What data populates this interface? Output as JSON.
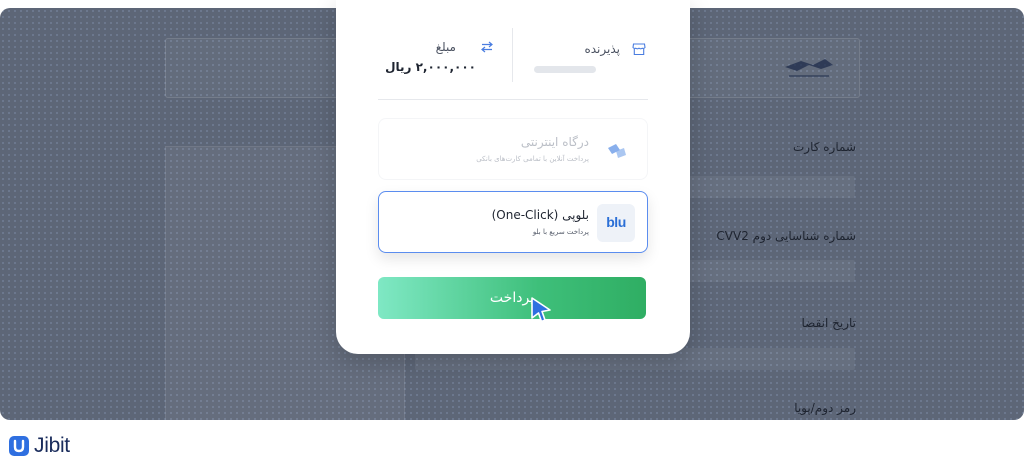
{
  "background_form": {
    "card_number_label": "شماره کارت",
    "cvv2_label": "شماره شناسایی دوم CVV2",
    "expiry_label": "تاریخ انقضا",
    "password_label": "رمز دوم/پویا"
  },
  "payment_modal": {
    "merchant_label": "پذیرنده",
    "amount_label": "مبلغ",
    "amount_value": "۲,۰۰۰,۰۰۰ ریال",
    "options": [
      {
        "title": "درگاه اینترنتی",
        "subtitle": "پرداخت آنلاین با تمامی کارت‌های بانکی",
        "icon": "gateway-logo-icon",
        "selected": false
      },
      {
        "title": "بلوپی (One-Click)",
        "subtitle": "پرداخت سریع با بلو",
        "icon_text": "blu",
        "selected": true
      }
    ],
    "pay_button_label": "پرداخت"
  },
  "brand": {
    "name": "Jibit"
  },
  "colors": {
    "accent_blue": "#5b8def",
    "pay_gradient_start": "#7fe8c4",
    "pay_gradient_end": "#2fae63",
    "brand_navy": "#1a2c5c"
  }
}
